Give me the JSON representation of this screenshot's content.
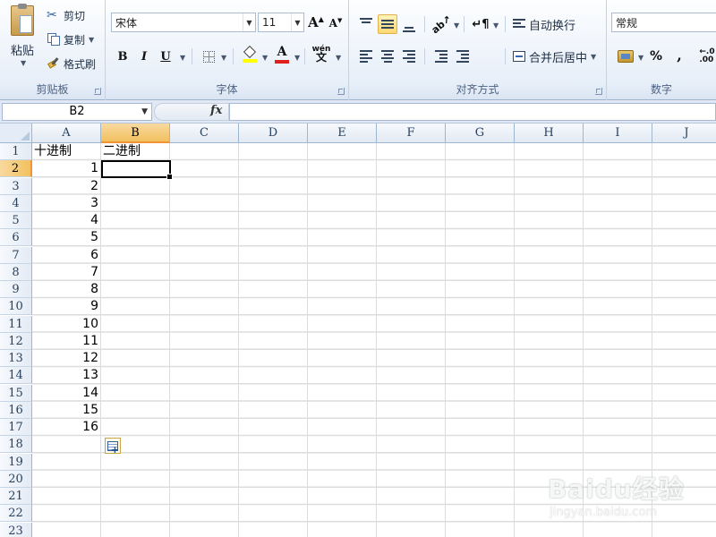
{
  "ribbon": {
    "clipboard": {
      "title": "剪贴板",
      "paste": "粘贴",
      "cut": "剪切",
      "copy": "复制",
      "format_painter": "格式刷"
    },
    "font": {
      "title": "字体",
      "font_name": "宋体",
      "font_size": "11",
      "bold": "B",
      "italic": "I",
      "underline": "U"
    },
    "alignment": {
      "title": "对齐方式",
      "wrap_text": "自动换行",
      "merge_center": "合并后居中"
    },
    "number": {
      "title": "数字",
      "format": "常规",
      "percent": "%",
      "comma": ","
    }
  },
  "formula_bar": {
    "name_box": "B2",
    "fx": "fx",
    "formula": ""
  },
  "grid": {
    "columns": [
      "A",
      "B",
      "C",
      "D",
      "E",
      "F",
      "G",
      "H",
      "I",
      "J"
    ],
    "selected_column": "B",
    "rows": [
      "1",
      "2",
      "3",
      "4",
      "5",
      "6",
      "7",
      "8",
      "9",
      "10",
      "11",
      "12",
      "13",
      "14",
      "15",
      "16",
      "17",
      "18",
      "19",
      "20",
      "21",
      "22",
      "23"
    ],
    "selected_row": "2",
    "header_a1": "十进制",
    "header_b1": "二进制",
    "a_values": [
      "1",
      "2",
      "3",
      "4",
      "5",
      "6",
      "7",
      "8",
      "9",
      "10",
      "11",
      "12",
      "13",
      "14",
      "15",
      "16"
    ]
  },
  "watermark": {
    "logo": "Baidu经验",
    "url": "jingyan.baidu.com"
  },
  "colors": {
    "accent": "#f29436",
    "ribbon_bg": "#e6eef8",
    "gridline": "#dadcdd"
  }
}
